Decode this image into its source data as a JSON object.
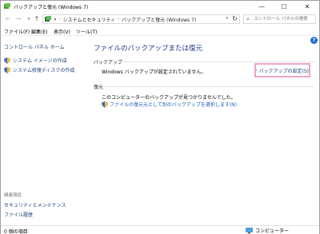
{
  "window": {
    "title": "バックアップと復元 (Windows 7)",
    "controls": {
      "minimize": "—",
      "maximize": "☐",
      "close": "✕"
    }
  },
  "nav": {
    "back_icon": "arrow-left",
    "forward_icon": "arrow-right",
    "up_icon": "arrow-up",
    "breadcrumb": [
      "«",
      "システムとセキュリティ",
      "バックアップと復元 (Windows 7)"
    ],
    "search_placeholder": "コントロール パネルの検索"
  },
  "menu": [
    "ファイル(F)",
    "編集(E)",
    "表示(V)",
    "ツール(T)"
  ],
  "sidebar": {
    "home": "コントロール パネル ホーム",
    "links": [
      {
        "label": "システム イメージの作成",
        "icon": "shield-icon"
      },
      {
        "label": "システム修復ディスクの作成",
        "icon": "shield-icon"
      }
    ],
    "see_also": "関連項目",
    "related": [
      "セキュリティとメンテナンス",
      "ファイル履歴"
    ]
  },
  "main": {
    "title": "ファイルのバックアップまたは復元",
    "backup": {
      "label": "バックアップ",
      "status": "Windows バックアップが設定されていません。",
      "setup_link": "バックアップの設定(S)"
    },
    "restore": {
      "label": "復元",
      "status": "このコンピューターのバックアップが見つかりませんでした。",
      "restore_link": "ファイルの復元元として別のバックアップを選択します(N)"
    }
  },
  "help": "?",
  "statusbar": {
    "count": "0 個の項目",
    "location": "コンピューター"
  },
  "colors": {
    "link": "#1a3d73",
    "title": "#1e3287",
    "highlight_border": "#e9a6c9",
    "help": "#1e6fd0"
  }
}
